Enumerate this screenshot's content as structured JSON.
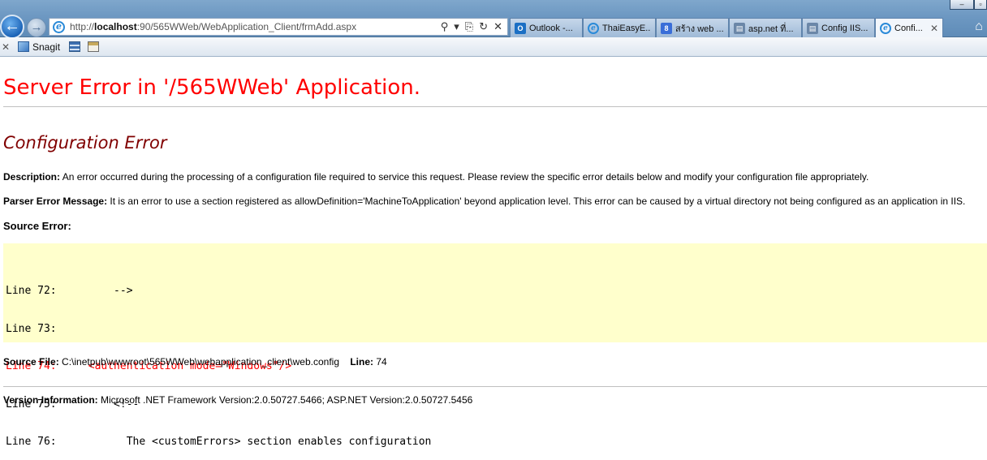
{
  "browser": {
    "window_controls": {
      "minimize": "‒",
      "maximize": "▫"
    },
    "address": {
      "url_prefix": "http://",
      "url_host": "localhost",
      "url_rest": ":90/565WWeb/WebApplication_Client/frmAdd.aspx",
      "tools": {
        "search": "⚲",
        "dropdown": "▾",
        "compat": "⎘",
        "refresh": "↻",
        "stop": "✕"
      }
    },
    "tabs": [
      {
        "label": "Outlook -...",
        "icon": "outlook-icon",
        "glyph": "O"
      },
      {
        "label": "ThaiEasyE...",
        "icon": "ie-icon",
        "glyph": "e"
      },
      {
        "label": "สร้าง web ...",
        "icon": "google-icon",
        "glyph": "8"
      },
      {
        "label": "asp.net ที่...",
        "icon": "page-icon",
        "glyph": "▤"
      },
      {
        "label": "Config IIS...",
        "icon": "page-icon",
        "glyph": "▤"
      },
      {
        "label": "Confi...",
        "icon": "ie-icon",
        "glyph": "e",
        "active": true,
        "close": "✕"
      }
    ],
    "home": "⌂",
    "toolbar": {
      "close": "✕",
      "snagit_label": "Snagit"
    }
  },
  "page": {
    "title": "Server Error in '/565WWeb' Application.",
    "subtitle": "Configuration Error",
    "description_label": "Description:",
    "description_text": " An error occurred during the processing of a configuration file required to service this request. Please review the specific error details below and modify your configuration file appropriately.",
    "parser_label": "Parser Error Message:",
    "parser_text": " It is an error to use a section registered as allowDefinition='MachineToApplication' beyond application level.  This error can be caused by a virtual directory not being configured as an application in IIS.",
    "source_error_label": "Source Error:",
    "code_lines": [
      {
        "text": "Line 72:         -->",
        "error": false
      },
      {
        "text": "Line 73:",
        "error": false
      },
      {
        "text": "Line 74:     <authentication mode=\"Windows\"/>",
        "error": true
      },
      {
        "text": "Line 75:         <!--",
        "error": false
      },
      {
        "text": "Line 76:           The <customErrors> section enables configuration",
        "error": false
      }
    ],
    "source_file_label": "Source File:",
    "source_file_value": " C:\\inetpub\\wwwroot\\565WWeb\\webapplication_client\\web.config",
    "line_label": "Line:",
    "line_value": " 74",
    "version_label": "Version Information:",
    "version_text": " Microsoft .NET Framework Version:2.0.50727.5466; ASP.NET Version:2.0.50727.5456"
  },
  "colors": {
    "title_red": "#ff0000",
    "subtitle_maroon": "#800000",
    "code_background": "#ffffcc",
    "code_error": "#ff0000"
  }
}
